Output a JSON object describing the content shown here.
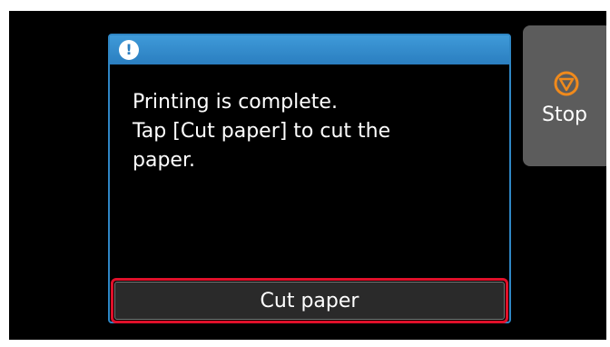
{
  "dialog": {
    "icon": "exclamation-icon",
    "message_lines": [
      "Printing is complete.",
      "Tap [Cut paper] to cut the",
      "paper."
    ],
    "button_label": "Cut paper"
  },
  "side_panel": {
    "stop_label": "Stop",
    "stop_icon": "stop-icon"
  },
  "colors": {
    "header_blue": "#2a7ec0",
    "highlight_red": "#e0102a",
    "stop_orange": "#f08a1c",
    "panel_gray": "#5c5c5c"
  }
}
